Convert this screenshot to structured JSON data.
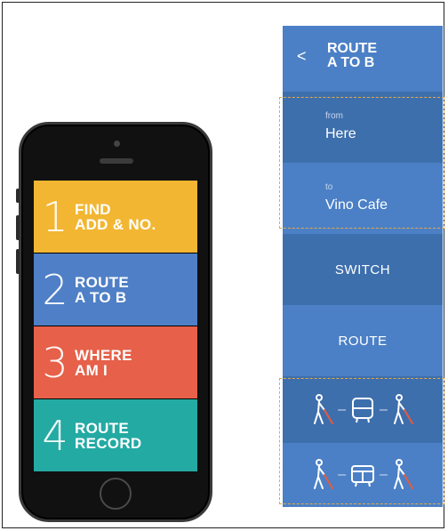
{
  "phone": {
    "menu": [
      {
        "num": "1",
        "line1": "FIND",
        "line2": "ADD & NO.",
        "color": "#f2b632"
      },
      {
        "num": "2",
        "line1": "ROUTE",
        "line2": "A TO B",
        "color": "#4f7fc6"
      },
      {
        "num": "3",
        "line1": "WHERE",
        "line2": "AM I",
        "color": "#e6604a"
      },
      {
        "num": "4",
        "line1": "ROUTE",
        "line2": "RECORD",
        "color": "#23aaa3"
      }
    ]
  },
  "panel": {
    "header": {
      "back": "<",
      "line1": "ROUTE",
      "line2": "A TO B"
    },
    "from": {
      "label": "from",
      "value": "Here"
    },
    "to": {
      "label": "to",
      "value": "Vino Cafe"
    },
    "switch_label": "SWITCH",
    "route_label": "ROUTE",
    "transit_options": [
      {
        "icons": [
          "walking-cane-icon",
          "bus-icon",
          "walking-cane-icon"
        ]
      },
      {
        "icons": [
          "walking-cane-icon",
          "tram-icon",
          "walking-cane-icon"
        ]
      }
    ]
  },
  "colors": {
    "panel_dark": "#3e6fad",
    "panel_light": "#4b80c6",
    "highlight": "#e7a842"
  }
}
